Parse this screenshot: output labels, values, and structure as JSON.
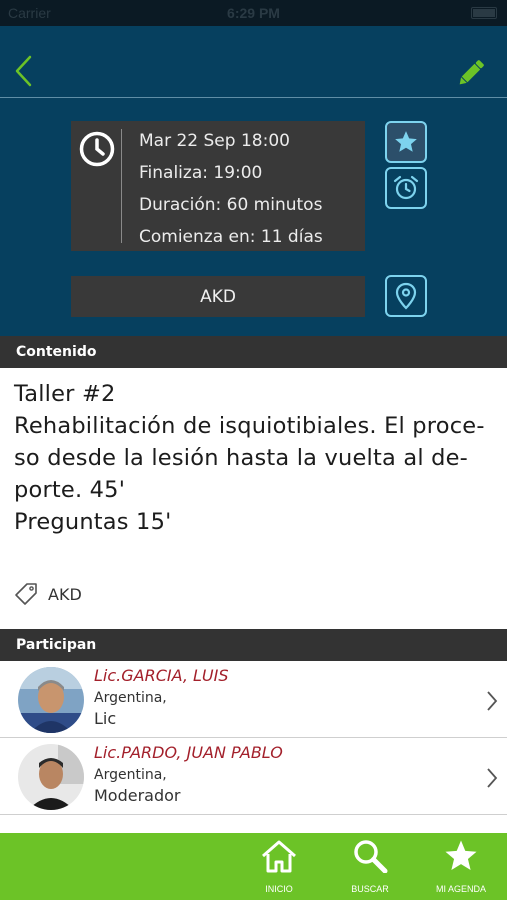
{
  "status_bar": {
    "carrier": "Carrier",
    "time": "6:29 PM"
  },
  "event": {
    "start": "Mar 22  Sep  18:00",
    "ends": "Finaliza: 19:00",
    "duration": "Duración: 60 minutos",
    "starts_in": "Comienza en: 11 días",
    "place": "AKD"
  },
  "content": {
    "header": "Contenido",
    "lines": [
      "Taller #2",
      "Rehabilitación de isquiotibiales. El proce-",
      "so desde la lesión hasta la vuelta al de-",
      "porte. 45'",
      "Preguntas 15'"
    ],
    "tag": "AKD"
  },
  "participants": {
    "header": "Participan",
    "items": [
      {
        "name": "Lic.GARCIA, LUIS",
        "country": "Argentina,",
        "role": "Lic"
      },
      {
        "name": "Lic.PARDO, JUAN PABLO",
        "country": "Argentina,",
        "role": "Moderador"
      }
    ]
  },
  "tabs": [
    {
      "label": "INICIO",
      "icon": "home-icon"
    },
    {
      "label": "BUSCAR",
      "icon": "search-icon"
    },
    {
      "label": "MI AGENDA",
      "icon": "star-icon"
    }
  ],
  "colors": {
    "header_bg": "#06405f",
    "accent_green": "#6cc327",
    "icon_cyan": "#7dd3ee",
    "name_red": "#a3202b",
    "box_gray": "#393939"
  }
}
